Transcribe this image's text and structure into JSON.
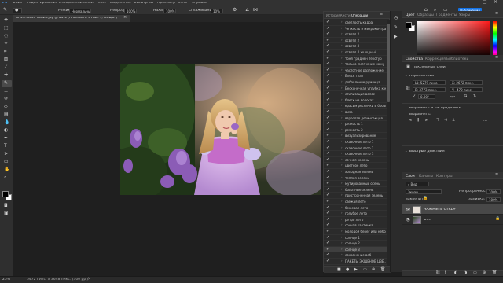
{
  "menubar": {
    "items": [
      "Ps",
      "Файл",
      "Редактирование",
      "Изображение",
      "Слои",
      "Текст",
      "Выделение",
      "Фильтр",
      "3D",
      "Просмотр",
      "Окно",
      "Справка"
    ]
  },
  "options": {
    "mode_label": "Режим:",
    "mode_value": "Нормальный",
    "opacity_label": "Непрозр.:",
    "opacity_value": "100%",
    "pressure_label": "Нажим:",
    "pressure_value": "100%",
    "smoothing_label": "Сглаживание:",
    "smoothing_value": "10%"
  },
  "document_tab": {
    "title": "AA47A3437 копия.jpg @ 25% (НАЖМИТЕ CTRL+T, RGB/8*) *"
  },
  "status": {
    "zoom": "25%",
    "size": "5472 пикс. x 3648 пикс. (300 ppi)"
  },
  "actions_panel": {
    "tabs": [
      "История",
      "Кисти",
      "Операции"
    ],
    "rows": [
      "светлость кадра",
      "Четкость и микроконтраст",
      "осветл 2",
      "осветл 2",
      "осветл 3",
      "осветл 4 холодный",
      "тонл градиен текстур",
      "только смягчение кожу",
      "частотное разложение",
      "Блеск глаз",
      "добавление румянца",
      "Бесконечная углубка к кожа",
      "стилизация волос",
      "блеск на волосах",
      "красим реснички и брови",
      "виза",
      "взрослая дезинсекция",
      "резкость 1",
      "резкость 2",
      "визуализирование",
      "сказочное лето 1",
      "сказочное лето 2",
      "сказочное лето 3",
      "сочная зелень",
      "цветное лето",
      "холодная зелень",
      "теплая зелень",
      "мутированный осень",
      "болотные зелень",
      "пристраненная зелень",
      "свежая лето",
      "бежевая лето",
      "голубое лето",
      "ретро лето",
      "сочная картинка",
      "молодой берег или небо",
      "солнце 1",
      "солнце 2",
      "солнце 3",
      "сохранение веб",
      "ПАКЕТЫ ЭКШЕНОВ ЦВЕ..."
    ],
    "selected_index": 38
  },
  "color_panel": {
    "tabs": [
      "Цвет",
      "Образцы",
      "Градиенты",
      "Узоры"
    ]
  },
  "properties_panel": {
    "tabs": [
      "Свойства",
      "Коррекция",
      "Библиотеки"
    ],
    "layer_type": "Пиксельный слой",
    "section_transform": "Перспектива",
    "w": "Ш: 5279 пикс.",
    "x": "X: 2672 пикс.",
    "h": "В: 3773 пикс.",
    "y": "Y: -470 пикс.",
    "angle": "0,00°",
    "ratio": "3/4",
    "section_align": "Выровнять и распределить",
    "align_label": "Выровнять:",
    "section_quick": "Быстрые действия"
  },
  "layers_panel": {
    "tabs": [
      "Слои",
      "Каналы",
      "Контуры"
    ],
    "filter_label": "Вид",
    "blend": "Экран",
    "opacity_label": "Непрозрачность:",
    "opacity_value": "100%",
    "lock_label": "Закрепить:",
    "fill_label": "Заливка:",
    "fill_value": "100%",
    "layers": [
      {
        "name": "НАЖМИТЕ CTRL+T",
        "selected": true
      },
      {
        "name": "Фон",
        "selected": false
      }
    ]
  },
  "share_button": "Публикация",
  "colors": {
    "accent": "#1473e6",
    "fg": "#000000",
    "bg": "#ffffff",
    "picker_hue": "#ff1a1a"
  }
}
